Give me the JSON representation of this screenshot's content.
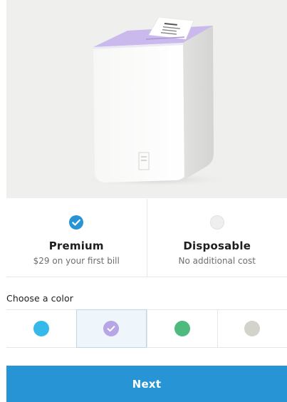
{
  "hero": {
    "image": "white-box-with-lavender-lid-and-receipt",
    "background_color": "#efefee"
  },
  "plans": [
    {
      "title": "Premium",
      "subtitle": "$29 on your first bill",
      "selected": true,
      "icon": "check-circle-icon"
    },
    {
      "title": "Disposable",
      "subtitle": "No additional cost",
      "selected": false,
      "icon": "empty-radio-icon"
    }
  ],
  "color_picker": {
    "label": "Choose a color",
    "options": [
      {
        "name": "blue",
        "hex": "#35b8ea",
        "selected": false
      },
      {
        "name": "lavender",
        "hex": "#b7a5e6",
        "selected": true
      },
      {
        "name": "green",
        "hex": "#4fba7e",
        "selected": false
      },
      {
        "name": "gray",
        "hex": "#d3d3cc",
        "selected": false
      }
    ]
  },
  "next_button": {
    "label": "Next"
  },
  "colors": {
    "accent": "#2795d5",
    "selected_swatch_bg": "#eef5fb",
    "text_primary": "#1d1d1d",
    "text_secondary": "#6e6e6e"
  }
}
